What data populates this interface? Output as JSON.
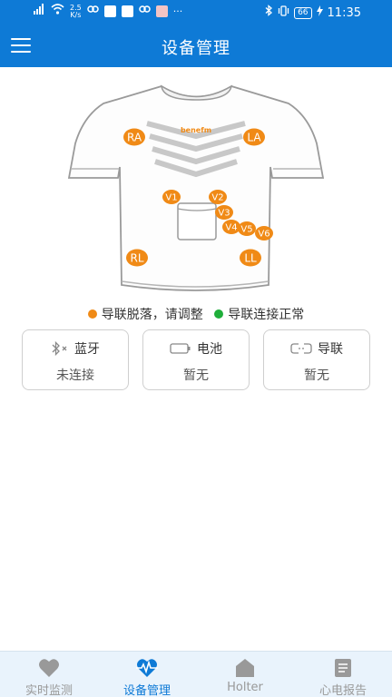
{
  "status_bar": {
    "net_speed_value": "2.5",
    "net_speed_unit": "K/s",
    "battery": "66",
    "time": "11:35",
    "more": "···"
  },
  "app_bar": {
    "title": "设备管理",
    "menu_icon": "hamburger-menu-icon"
  },
  "shirt": {
    "brand": "benefm",
    "electrodes": [
      "RA",
      "LA",
      "V1",
      "V2",
      "V3",
      "V4",
      "V5",
      "V6",
      "RL",
      "LL"
    ],
    "electrode_color": "#f08a16"
  },
  "legend": {
    "items": [
      {
        "color": "#f08a16",
        "label": "导联脱落，请调整"
      },
      {
        "color": "#1fae3a",
        "label": "导联连接正常"
      }
    ]
  },
  "cards": [
    {
      "icon": "bluetooth-off-icon",
      "title": "蓝牙",
      "value": "未连接"
    },
    {
      "icon": "battery-icon",
      "title": "电池",
      "value": "暂无"
    },
    {
      "icon": "link-icon",
      "title": "导联",
      "value": "暂无"
    }
  ],
  "bottom_nav": {
    "items": [
      {
        "icon": "heart-icon",
        "label": "实时监测",
        "active": false
      },
      {
        "icon": "ecg-heart-icon",
        "label": "设备管理",
        "active": true
      },
      {
        "icon": "home-icon",
        "label": "Holter",
        "active": false
      },
      {
        "icon": "report-icon",
        "label": "心电报告",
        "active": false
      }
    ],
    "active_color": "#0e7ad6",
    "inactive_color": "#999999"
  }
}
